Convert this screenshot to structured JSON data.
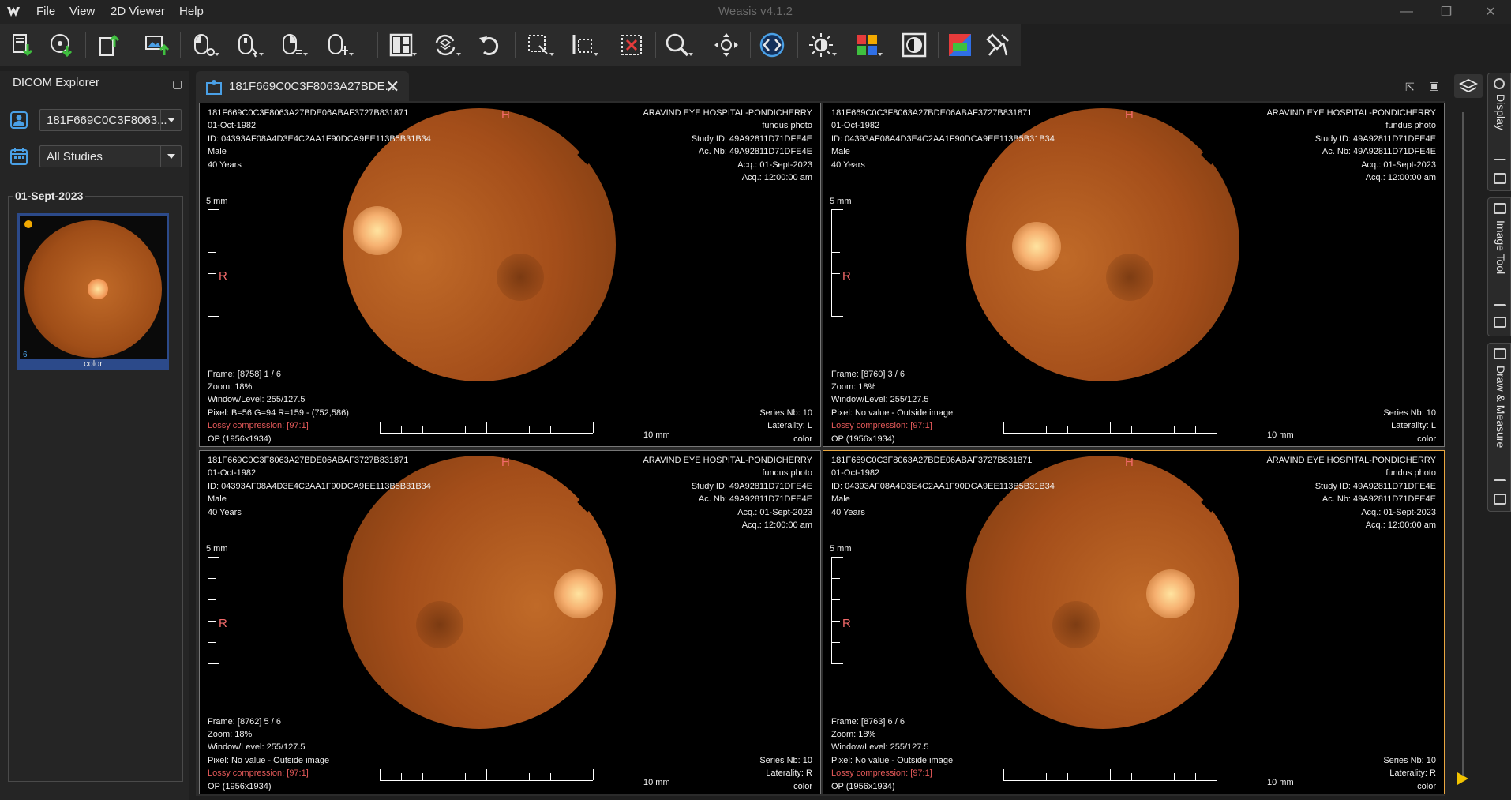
{
  "window": {
    "title": "Weasis v4.1.2"
  },
  "menu": {
    "file": "File",
    "view": "View",
    "viewer": "2D Viewer",
    "help": "Help"
  },
  "explorer": {
    "title": "DICOM Explorer",
    "patient_combo": "181F669C0C3F8063...",
    "studies_combo": "All Studies",
    "study_date": "01-Sept-2023",
    "thumb_count": "6",
    "thumb_label": "color"
  },
  "tab": {
    "label": "181F669C0C3F8063A27BDE..."
  },
  "side_panels": {
    "display": "Display",
    "image_tool": "Image Tool",
    "draw_measure": "Draw & Measure"
  },
  "viewports": [
    {
      "left": [
        "181F669C0C3F8063A27BDE06ABAF3727B831871",
        "01-Oct-1982",
        "ID: 04393AF08A4D3E4C2AA1F90DCA9EE113B5B31B34",
        "Male",
        "40 Years"
      ],
      "right": [
        "ARAVIND EYE HOSPITAL-PONDICHERRY",
        "fundus photo",
        "Study ID: 49A92811D71DFE4E",
        "Ac. Nb: 49A92811D71DFE4E",
        "Acq.: 01-Sept-2023",
        "Acq.: 12:00:00 am"
      ],
      "frame": "Frame: [8758] 1 / 6",
      "zoom": "Zoom: 18%",
      "wl": "Window/Level: 255/127.5",
      "pixel": "Pixel:  B=56 G=94 R=159 - (752,586)",
      "lossy": "Lossy compression:  [97:1]",
      "op": "OP (1956x1934)",
      "series": "Series Nb: 10",
      "laterality": "Laterality: L",
      "color": "color",
      "orient_top": "H",
      "orient_left": "R",
      "scale_v": "5 mm",
      "scale_h": "10 mm"
    },
    {
      "left": [
        "181F669C0C3F8063A27BDE06ABAF3727B831871",
        "01-Oct-1982",
        "ID: 04393AF08A4D3E4C2AA1F90DCA9EE113B5B31B34",
        "Male",
        "40 Years"
      ],
      "right": [
        "ARAVIND EYE HOSPITAL-PONDICHERRY",
        "fundus photo",
        "Study ID: 49A92811D71DFE4E",
        "Ac. Nb: 49A92811D71DFE4E",
        "Acq.: 01-Sept-2023",
        "Acq.: 12:00:00 am"
      ],
      "frame": "Frame: [8760] 3 / 6",
      "zoom": "Zoom: 18%",
      "wl": "Window/Level: 255/127.5",
      "pixel": "Pixel: No value - Outside image",
      "lossy": "Lossy compression:  [97:1]",
      "op": "OP (1956x1934)",
      "series": "Series Nb: 10",
      "laterality": "Laterality: L",
      "color": "color",
      "orient_top": "H",
      "orient_left": "R",
      "scale_v": "5 mm",
      "scale_h": "10 mm"
    },
    {
      "left": [
        "181F669C0C3F8063A27BDE06ABAF3727B831871",
        "01-Oct-1982",
        "ID: 04393AF08A4D3E4C2AA1F90DCA9EE113B5B31B34",
        "Male",
        "40 Years"
      ],
      "right": [
        "ARAVIND EYE HOSPITAL-PONDICHERRY",
        "fundus photo",
        "Study ID: 49A92811D71DFE4E",
        "Ac. Nb: 49A92811D71DFE4E",
        "Acq.: 01-Sept-2023",
        "Acq.: 12:00:00 am"
      ],
      "frame": "Frame: [8762] 5 / 6",
      "zoom": "Zoom: 18%",
      "wl": "Window/Level: 255/127.5",
      "pixel": "Pixel: No value - Outside image",
      "lossy": "Lossy compression:  [97:1]",
      "op": "OP (1956x1934)",
      "series": "Series Nb: 10",
      "laterality": "Laterality: R",
      "color": "color",
      "orient_top": "H",
      "orient_left": "R",
      "scale_v": "5 mm",
      "scale_h": "10 mm"
    },
    {
      "left": [
        "181F669C0C3F8063A27BDE06ABAF3727B831871",
        "01-Oct-1982",
        "ID: 04393AF08A4D3E4C2AA1F90DCA9EE113B5B31B34",
        "Male",
        "40 Years"
      ],
      "right": [
        "ARAVIND EYE HOSPITAL-PONDICHERRY",
        "fundus photo",
        "Study ID: 49A92811D71DFE4E",
        "Ac. Nb: 49A92811D71DFE4E",
        "Acq.: 01-Sept-2023",
        "Acq.: 12:00:00 am"
      ],
      "frame": "Frame: [8763] 6 / 6",
      "zoom": "Zoom: 18%",
      "wl": "Window/Level: 255/127.5",
      "pixel": "Pixel: No value - Outside image",
      "lossy": "Lossy compression:  [97:1]",
      "op": "OP (1956x1934)",
      "series": "Series Nb: 10",
      "laterality": "Laterality: R",
      "color": "color",
      "orient_top": "H",
      "orient_left": "R",
      "scale_v": "5 mm",
      "scale_h": "10 mm"
    }
  ],
  "colors": {
    "selected_border": "#e8a640",
    "thumb_border": "#2c4a8a",
    "lossy": "#e65a5a",
    "orientation": "#f26a6a",
    "fundus_outer": "#7a3a10",
    "fundus_inner": "#c06a28",
    "optic_disc": "#ffe4a0"
  },
  "icons": [
    "import-dicom-icon",
    "import-cd-icon",
    "export-dicom-icon",
    "export-image-icon",
    "mouse-left-icon",
    "mouse-middle-icon",
    "mouse-right-icon",
    "mouse-wheel-icon",
    "layout-icon",
    "synch-icon",
    "reset-icon",
    "crop-icon",
    "select-icon",
    "delete-selection-icon",
    "zoom-icon",
    "pan-icon",
    "cine-icon",
    "wl-preset-icon",
    "lut-icon",
    "invert-icon",
    "colormap-icon",
    "pin-icon"
  ]
}
